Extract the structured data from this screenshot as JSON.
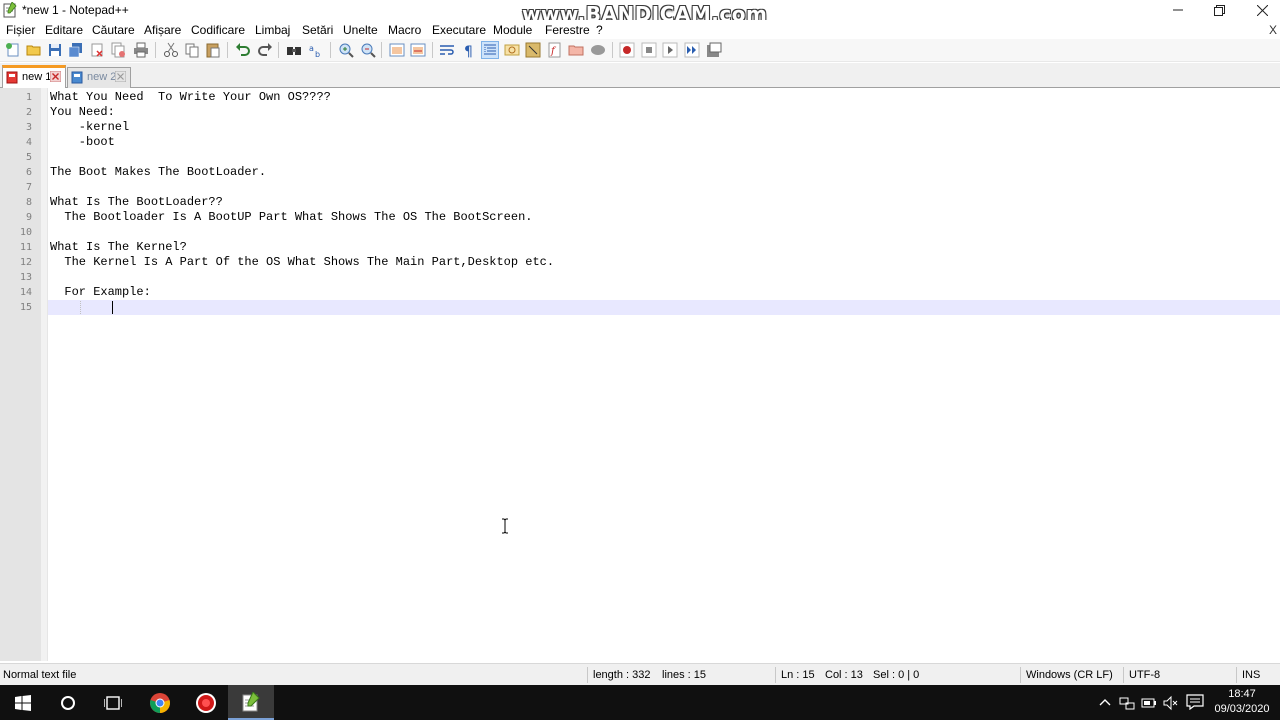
{
  "window": {
    "title": "*new 1 - Notepad++",
    "watermark": "www.BANDICAM.com"
  },
  "menu": [
    "Fișier",
    "Editare",
    "Căutare",
    "Afișare",
    "Codificare",
    "Limbaj",
    "Setări",
    "Unelte",
    "Macro",
    "Executare",
    "Module",
    "Ferestre",
    "?"
  ],
  "menu_close": "X",
  "tabs": [
    {
      "label": "new 1",
      "state": "active-modified"
    },
    {
      "label": "new 2",
      "state": "inactive"
    }
  ],
  "editor": {
    "lines": [
      {
        "num": "1",
        "text": "What You Need  To Write Your Own OS????"
      },
      {
        "num": "2",
        "text": "You Need:"
      },
      {
        "num": "3",
        "text": "    -kernel"
      },
      {
        "num": "4",
        "text": "    -boot"
      },
      {
        "num": "5",
        "text": ""
      },
      {
        "num": "6",
        "text": "The Boot Makes The BootLoader."
      },
      {
        "num": "7",
        "text": ""
      },
      {
        "num": "8",
        "text": "What Is The BootLoader??"
      },
      {
        "num": "9",
        "text": "  The Bootloader Is A BootUP Part What Shows The OS The BootScreen."
      },
      {
        "num": "10",
        "text": ""
      },
      {
        "num": "11",
        "text": "What Is The Kernel?"
      },
      {
        "num": "12",
        "text": "  The Kernel Is A Part Of the OS What Shows The Main Part,Desktop etc."
      },
      {
        "num": "13",
        "text": ""
      },
      {
        "num": "14",
        "text": "  For Example:"
      },
      {
        "num": "15",
        "text": ""
      }
    ]
  },
  "status": {
    "file_type": "Normal text file",
    "length": "length : 332",
    "lines": "lines : 15",
    "ln": "Ln : 15",
    "col": "Col : 13",
    "sel": "Sel : 0 | 0",
    "eol": "Windows (CR LF)",
    "encoding": "UTF-8",
    "mode": "INS"
  },
  "taskbar": {
    "time": "18:47",
    "date": "09/03/2020"
  },
  "colors": {
    "tab_accent": "#f59a23",
    "current_line": "#e8e8ff",
    "taskbar_bg": "#101010"
  }
}
